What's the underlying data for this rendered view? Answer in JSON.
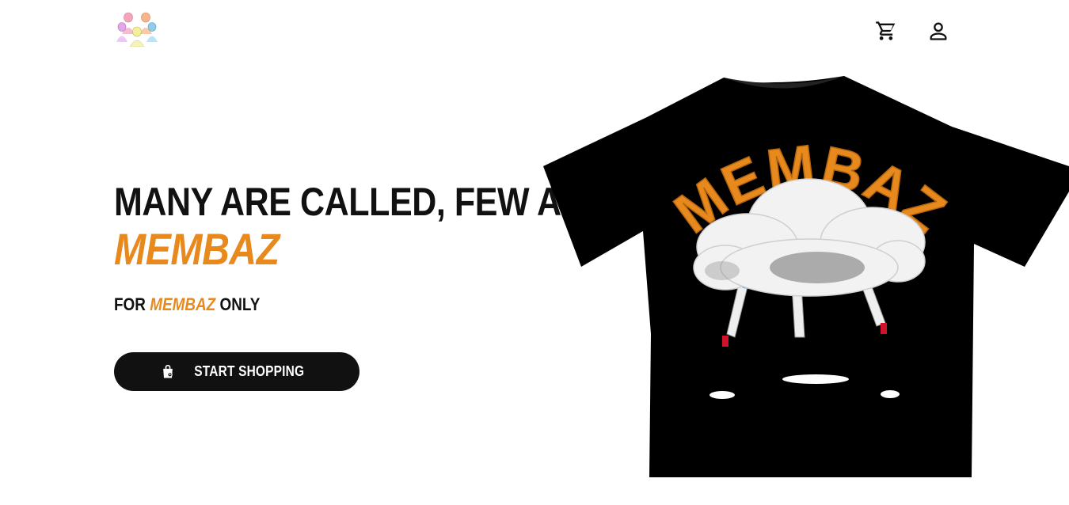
{
  "header": {
    "logo_icon": "group-of-people-logo",
    "cart_icon": "cart-icon",
    "account_icon": "user-icon"
  },
  "hero": {
    "headline": "MANY ARE CALLED, FEW ARE",
    "brand": "MEMBAZ",
    "sub_prefix": "FOR",
    "sub_brand": "MEMBAZ",
    "sub_suffix": "ONLY",
    "cta_label": "START SHOPPING",
    "cta_icon": "shopping-bag-icon"
  },
  "product": {
    "shirt_print_text": "MEMBAZ",
    "shirt_color": "#000000"
  },
  "colors": {
    "accent": "#e8891e",
    "text": "#111111",
    "button_bg": "#111111"
  }
}
